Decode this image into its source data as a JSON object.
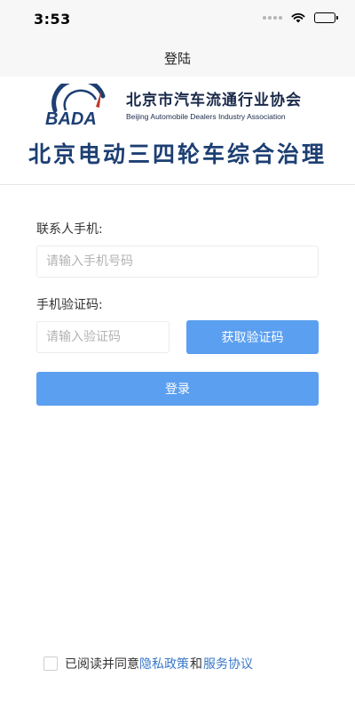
{
  "status_bar": {
    "time": "3:53"
  },
  "nav": {
    "title": "登陆"
  },
  "brand": {
    "logo_text": "BADA",
    "association_cn": "北京市汽车流通行业协会",
    "association_en": "Beijing Automobile Dealers Industry Association",
    "title": "北京电动三四轮车综合治理"
  },
  "form": {
    "phone_label": "联系人手机:",
    "phone_placeholder": "请输入手机号码",
    "code_label": "手机验证码:",
    "code_placeholder": "请输入验证码",
    "get_code_label": "获取验证码",
    "login_label": "登录"
  },
  "agreement": {
    "prefix": "已阅读并同意",
    "privacy_link": "隐私政策",
    "and": "和",
    "service_link": "服务协议"
  },
  "colors": {
    "primary_button": "#5b9ff0",
    "link": "#3a78c9",
    "brand_title": "#1d3f73",
    "logo_accent": "#c0392b"
  }
}
